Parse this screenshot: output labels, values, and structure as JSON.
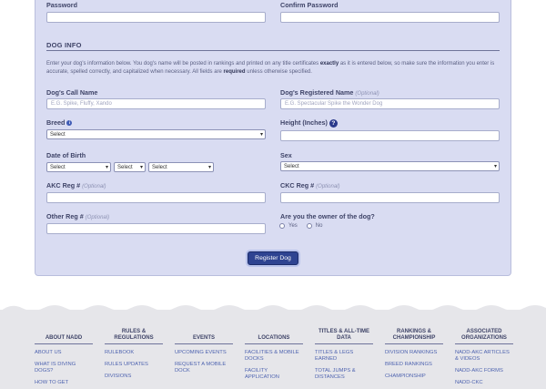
{
  "form": {
    "password_label": "Password",
    "confirm_password_label": "Confirm Password",
    "section_title": "DOG INFO",
    "intro_part1": "Enter your dog's information below. You dog's name will be posted in rankings and printed on any title certificates ",
    "intro_bold1": "exactly",
    "intro_part2": " as it is entered below, so make sure the information you enter is accurate, spelled correctly, and capitalized when necessary. All fields are ",
    "intro_bold2": "required",
    "intro_part3": " unless otherwise specified.",
    "call_name_label": "Dog's Call Name",
    "call_name_placeholder": "E.G. Spike, Fluffy, Xando",
    "registered_name_label": "Dog's Registered Name",
    "registered_name_placeholder": "E.G. Spectacular Spike the Wonder Dog",
    "optional_text": "(Optional)",
    "breed_label": "Breed",
    "breed_value": "Select",
    "height_label": "Height (Inches)",
    "dob_label": "Date of Birth",
    "dob_month": "Select",
    "dob_day": "Select",
    "dob_year": "Select",
    "sex_label": "Sex",
    "sex_value": "Select",
    "akc_label": "AKC Reg #",
    "ckc_label": "CKC Reg #",
    "other_label": "Other Reg #",
    "owner_question": "Are you the owner of the dog?",
    "owner_yes": "Yes",
    "owner_no": "No",
    "submit_label": "Register Dog"
  },
  "footer": {
    "columns": [
      {
        "heading": "ABOUT NADD",
        "links": [
          "ABOUT US",
          "WHAT IS DIVING DOGS?",
          "HOW TO GET"
        ]
      },
      {
        "heading": "RULES & REGULATIONS",
        "links": [
          "RULEBOOK",
          "RULES UPDATES",
          "DIVISIONS"
        ]
      },
      {
        "heading": "EVENTS",
        "links": [
          "UPCOMING EVENTS",
          "REQUEST A MOBILE DOCK"
        ]
      },
      {
        "heading": "LOCATIONS",
        "links": [
          "FACILITIES & MOBILE DOCKS",
          "FACILITY APPLICATION"
        ]
      },
      {
        "heading": "TITLES & ALL-TIME DATA",
        "links": [
          "TITLES & LEGS EARNED",
          "TOTAL JUMPS & DISTANCES"
        ]
      },
      {
        "heading": "RANKINGS & CHAMPIONSHIP",
        "links": [
          "DIVISION RANKINGS",
          "BREED RANKINGS",
          "CHAMPIONSHIP"
        ]
      },
      {
        "heading": "ASSOCIATED ORGANIZATIONS",
        "links": [
          "NADD-AKC ARTICLES & VIDEOS",
          "NADD-AKC FORMS",
          "NADD-CKC"
        ]
      }
    ]
  }
}
